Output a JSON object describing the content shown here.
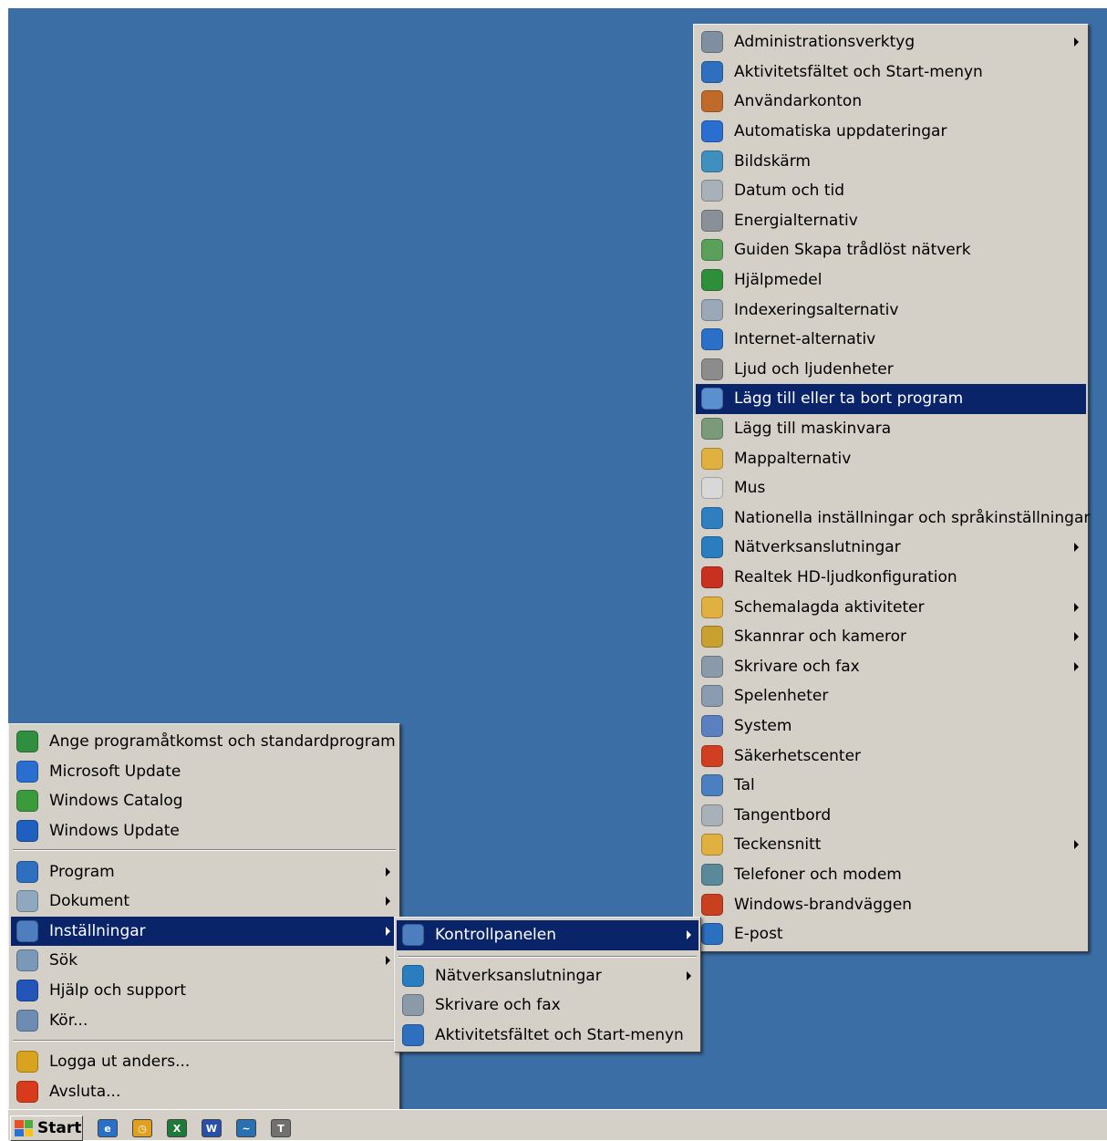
{
  "start_menu": {
    "top_items": [
      {
        "label": "Ange programåtkomst och standardprogram",
        "icon": "program-access-icon",
        "color": "#2f8f3f"
      },
      {
        "label": "Microsoft Update",
        "icon": "microsoft-update-icon",
        "color": "#2a6fd0"
      },
      {
        "label": "Windows Catalog",
        "icon": "windows-catalog-icon",
        "color": "#3b9a3b"
      },
      {
        "label": "Windows Update",
        "icon": "windows-update-icon",
        "color": "#1f5fbf"
      }
    ],
    "main_items": [
      {
        "label": "Program",
        "icon": "programs-icon",
        "color": "#2f6fbf"
      },
      {
        "label": "Dokument",
        "icon": "documents-icon",
        "color": "#8fa8c0"
      },
      {
        "label": "Inställningar",
        "icon": "settings-icon",
        "color": "#4d7fc0"
      },
      {
        "label": "Sök",
        "icon": "search-icon",
        "color": "#7a98b8"
      },
      {
        "label": "Hjälp och support",
        "icon": "help-icon",
        "color": "#2355b8"
      },
      {
        "label": "Kör...",
        "icon": "run-icon",
        "color": "#6c8cb4"
      }
    ],
    "bottom_items": [
      {
        "label": "Logga ut anders...",
        "icon": "logoff-icon",
        "color": "#d9a21f"
      },
      {
        "label": "Avsluta...",
        "icon": "shutdown-icon",
        "color": "#d83a1c"
      }
    ]
  },
  "settings_menu": {
    "items": [
      {
        "label": "Kontrollpanelen",
        "icon": "control-panel-icon",
        "color": "#4d7fc0"
      },
      {
        "label": "Nätverksanslutningar",
        "icon": "network-icon",
        "color": "#2a7ec0"
      },
      {
        "label": "Skrivare och fax",
        "icon": "printer-icon",
        "color": "#8a9aa8"
      },
      {
        "label": "Aktivitetsfältet och Start-menyn",
        "icon": "taskbar-icon",
        "color": "#2f6fbf"
      }
    ]
  },
  "control_panel_menu": {
    "items": [
      {
        "label": "Administrationsverktyg",
        "icon": "admin-tools-icon",
        "color": "#7f8f9f",
        "submenu": true
      },
      {
        "label": "Aktivitetsfältet och Start-menyn",
        "icon": "taskbar-icon",
        "color": "#2f6fbf",
        "submenu": false
      },
      {
        "label": "Användarkonton",
        "icon": "user-accounts-icon",
        "color": "#c06a2a",
        "submenu": false
      },
      {
        "label": "Automatiska uppdateringar",
        "icon": "auto-update-icon",
        "color": "#2a6fd0",
        "submenu": false
      },
      {
        "label": "Bildskärm",
        "icon": "display-icon",
        "color": "#3f8fbf",
        "submenu": false
      },
      {
        "label": "Datum och tid",
        "icon": "clock-icon",
        "color": "#a8b0b8",
        "submenu": false
      },
      {
        "label": "Energialternativ",
        "icon": "power-icon",
        "color": "#8a9098",
        "submenu": false
      },
      {
        "label": "Guiden Skapa trådlöst nätverk",
        "icon": "wireless-icon",
        "color": "#5aa05a",
        "submenu": false
      },
      {
        "label": "Hjälpmedel",
        "icon": "accessibility-icon",
        "color": "#2e8f3a",
        "submenu": false
      },
      {
        "label": "Indexeringsalternativ",
        "icon": "indexing-icon",
        "color": "#9aa8b8",
        "submenu": false
      },
      {
        "label": "Internet-alternativ",
        "icon": "internet-options-icon",
        "color": "#2a70c8",
        "submenu": false
      },
      {
        "label": "Ljud och ljudenheter",
        "icon": "sound-icon",
        "color": "#8c8c8c",
        "submenu": false
      },
      {
        "label": "Lägg till eller ta bort program",
        "icon": "add-remove-icon",
        "color": "#5a8fd0",
        "submenu": false
      },
      {
        "label": "Lägg till maskinvara",
        "icon": "hardware-icon",
        "color": "#7a9a7a",
        "submenu": false
      },
      {
        "label": "Mappalternativ",
        "icon": "folder-options-icon",
        "color": "#e0b040",
        "submenu": false
      },
      {
        "label": "Mus",
        "icon": "mouse-icon",
        "color": "#d8d8d8",
        "submenu": false
      },
      {
        "label": "Nationella inställningar och språkinställningar",
        "icon": "regional-icon",
        "color": "#2f7fc0",
        "submenu": false
      },
      {
        "label": "Nätverksanslutningar",
        "icon": "network-icon",
        "color": "#2a7ec0",
        "submenu": true
      },
      {
        "label": "Realtek HD-ljudkonfiguration",
        "icon": "speaker-icon",
        "color": "#c8301f",
        "submenu": false
      },
      {
        "label": "Schemalagda aktiviteter",
        "icon": "scheduled-tasks-icon",
        "color": "#e0b040",
        "submenu": true
      },
      {
        "label": "Skannrar och kameror",
        "icon": "scanner-icon",
        "color": "#c8a030",
        "submenu": true
      },
      {
        "label": "Skrivare och fax",
        "icon": "printer-icon",
        "color": "#8a9aa8",
        "submenu": true
      },
      {
        "label": "Spelenheter",
        "icon": "gamepad-icon",
        "color": "#8a9ab0",
        "submenu": false
      },
      {
        "label": "System",
        "icon": "system-icon",
        "color": "#5a80c0",
        "submenu": false
      },
      {
        "label": "Säkerhetscenter",
        "icon": "security-center-icon",
        "color": "#d04020",
        "submenu": false
      },
      {
        "label": "Tal",
        "icon": "speech-icon",
        "color": "#4a80c0",
        "submenu": false
      },
      {
        "label": "Tangentbord",
        "icon": "keyboard-icon",
        "color": "#a8b0b8",
        "submenu": false
      },
      {
        "label": "Teckensnitt",
        "icon": "fonts-icon",
        "color": "#e0b040",
        "submenu": true
      },
      {
        "label": "Telefoner och modem",
        "icon": "phone-icon",
        "color": "#5a8a9a",
        "submenu": false
      },
      {
        "label": "Windows-brandväggen",
        "icon": "firewall-icon",
        "color": "#c84020",
        "submenu": false
      },
      {
        "label": "E-post",
        "icon": "email-icon",
        "color": "#2a6fc0",
        "submenu": false
      }
    ]
  },
  "taskbar": {
    "start_label": "Start",
    "quick_launch": [
      {
        "icon": "internet-explorer-icon",
        "glyph": "e",
        "color": "#2a70c8"
      },
      {
        "icon": "clock-app-icon",
        "glyph": "◷",
        "color": "#e0a020"
      },
      {
        "icon": "excel-icon",
        "glyph": "X",
        "color": "#1f7a3a"
      },
      {
        "icon": "word-icon",
        "glyph": "W",
        "color": "#2a4fa8"
      },
      {
        "icon": "graph-app-icon",
        "glyph": "~",
        "color": "#2a6fb0"
      },
      {
        "icon": "terminal-icon",
        "glyph": "T",
        "color": "#707070"
      }
    ]
  }
}
